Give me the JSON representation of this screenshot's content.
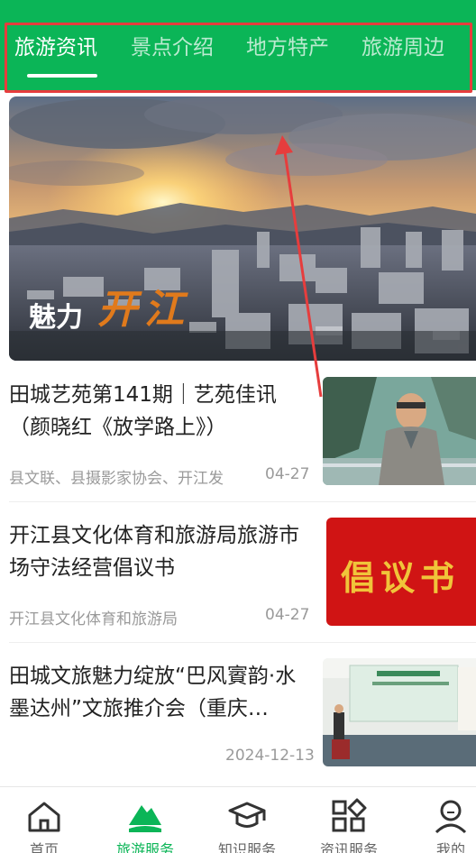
{
  "tabs": [
    {
      "label": "旅游资讯",
      "active": true
    },
    {
      "label": "景点介绍",
      "active": false
    },
    {
      "label": "地方特产",
      "active": false
    },
    {
      "label": "旅游周边",
      "active": false
    }
  ],
  "banner": {
    "text_prefix": "魅力",
    "text_script": "开江"
  },
  "news": [
    {
      "title": "田城艺苑第141期｜艺苑佳讯（颜晓红《放学路上》）",
      "source": "县文联、县摄影家协会、开江发",
      "date": "04-27"
    },
    {
      "title": "开江县文化体育和旅游局旅游市场守法经营倡议书",
      "source": "开江县文化体育和旅游局",
      "date": "04-27",
      "thumb_text": "倡议书"
    },
    {
      "title": "田城文旅魅力绽放“巴风賨韵·水墨达州”文旅推介会（重庆…",
      "source": "",
      "date": "2024-12-13"
    }
  ],
  "bottom_nav": [
    {
      "label": "首页",
      "icon": "home-icon",
      "active": false
    },
    {
      "label": "旅游服务",
      "icon": "mountain-icon",
      "active": true
    },
    {
      "label": "知识服务",
      "icon": "graduation-cap-icon",
      "active": false
    },
    {
      "label": "资讯服务",
      "icon": "grid-icon",
      "active": false
    },
    {
      "label": "我的",
      "icon": "user-icon",
      "active": false
    }
  ],
  "colors": {
    "brand_green": "#0bb557",
    "annotation_red": "#e63d3d",
    "text": "#222222",
    "muted": "#9a9a9a"
  }
}
